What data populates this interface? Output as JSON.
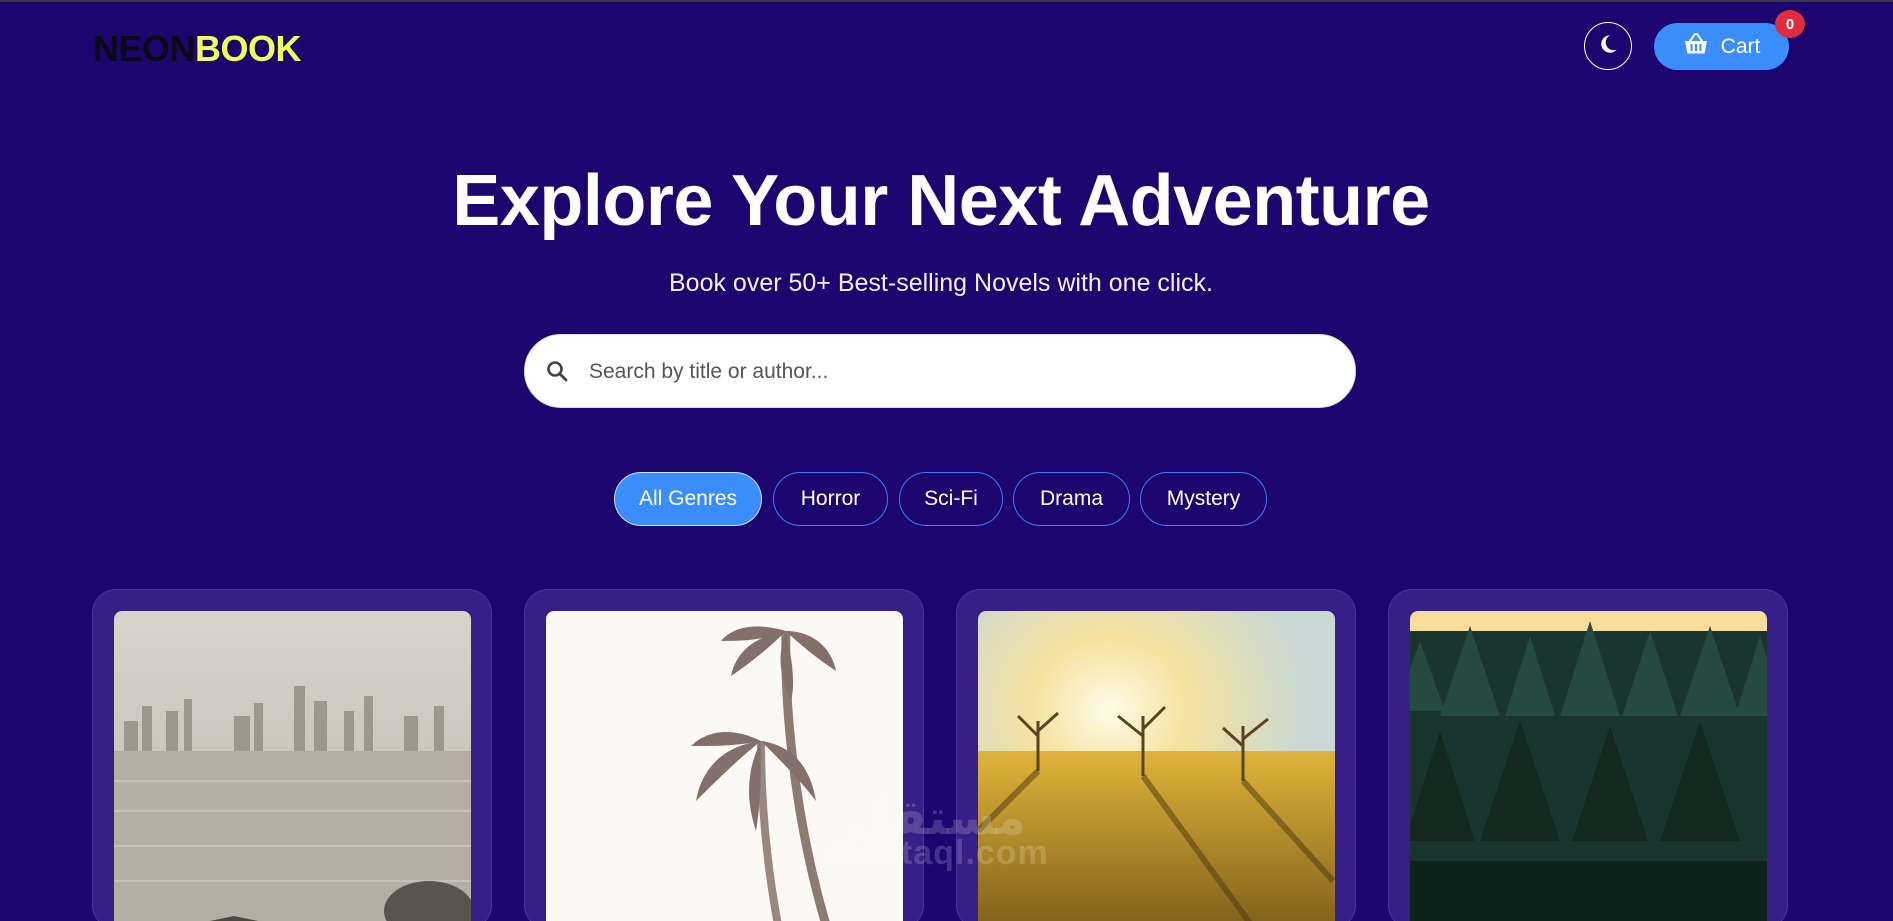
{
  "brand": {
    "part1": "NEON",
    "part2": "BOOK"
  },
  "header": {
    "theme_toggle_icon": "moon-icon",
    "cart_label": "Cart",
    "cart_icon": "basket-icon",
    "cart_count": "0"
  },
  "hero": {
    "title": "Explore Your Next Adventure",
    "subtitle": "Book over 50+ Best-selling Novels with one click."
  },
  "search": {
    "placeholder": "Search by title or author...",
    "icon": "search-icon"
  },
  "genres": [
    {
      "label": "All Genres",
      "active": true
    },
    {
      "label": "Horror",
      "active": false
    },
    {
      "label": "Sci-Fi",
      "active": false
    },
    {
      "label": "Drama",
      "active": false
    },
    {
      "label": "Mystery",
      "active": false
    }
  ],
  "books": [
    {
      "cover": "city-skyline-water-image"
    },
    {
      "cover": "palm-trees-image"
    },
    {
      "cover": "sunlit-field-trees-image"
    },
    {
      "cover": "dark-forest-image"
    }
  ],
  "watermark": {
    "arabic": "مستقل",
    "latin": "mostaql.com"
  },
  "colors": {
    "background": "#1d0570",
    "accent": "#3b8dfb",
    "brand_yellow": "#f1ff5a",
    "badge": "#e02d3c",
    "card": "#361f86"
  }
}
